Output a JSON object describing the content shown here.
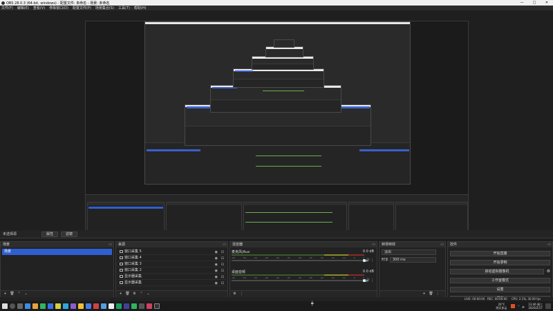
{
  "window": {
    "title": "OBS 28.0.3 (64-bit, windows) - 配置文件: 未命名 - 场景: 未命名",
    "minimize": "—",
    "maximize": "□",
    "close": "✕"
  },
  "menu": [
    "文件(F)",
    "编辑(E)",
    "查看(V)",
    "停靠窗口(D)",
    "配置文件(P)",
    "场景集合(S)",
    "工具(T)",
    "帮助(H)"
  ],
  "dock_header": {
    "label": "未选择源",
    "properties": "属性",
    "filters": "滤镜"
  },
  "scenes": {
    "title": "场景",
    "items": [
      "场景"
    ]
  },
  "sources": {
    "title": "来源",
    "items": [
      "窗口采集 5",
      "窗口采集 4",
      "窗口采集 3",
      "窗口采集 2",
      "显示器采集",
      "显示器采集"
    ]
  },
  "mixer": {
    "title": "混音器",
    "channels": [
      {
        "name": "麦克风/Aux",
        "db": "0.0 dB"
      },
      {
        "name": "桌面音频",
        "db": "0.0 dB"
      }
    ],
    "ticks": [
      "-60",
      "-55",
      "-50",
      "-45",
      "-40",
      "-35",
      "-30",
      "-25",
      "-20",
      "-15",
      "-10",
      "-5",
      "0"
    ]
  },
  "transitions": {
    "title": "转场特效",
    "selected": "淡出",
    "duration_label": "时长",
    "duration_value": "300 ms"
  },
  "controls": {
    "title": "控件",
    "buttons": [
      "开始直播",
      "开始录制",
      "启动虚拟摄像机",
      "工作室模式",
      "设置",
      "退出"
    ]
  },
  "status": {
    "live": "LIVE: 00:00:00",
    "rec": "REC: 00:00:00",
    "cpu": "CPU: 2.1%, 30.00 fps"
  },
  "tray": {
    "weather": "20°C",
    "weather2": "阴天多云",
    "time": "13:46 周三",
    "date": "2020/2/17"
  },
  "colors": {
    "accent": "#2f5fd0",
    "meter_green": "#6ab04c"
  }
}
